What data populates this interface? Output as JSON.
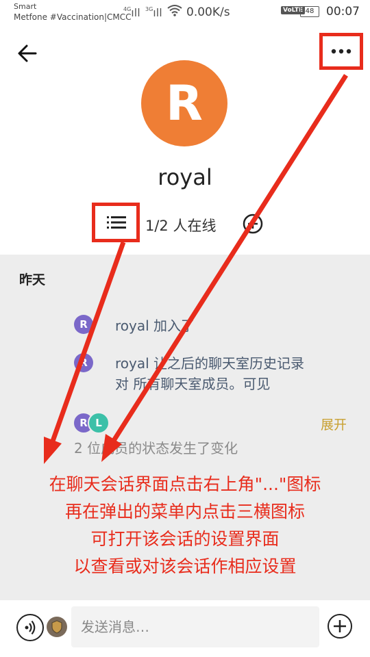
{
  "status_bar": {
    "carrier_line1": "Smart",
    "carrier_line2": "Metfone #Vaccination|CMCC",
    "signal1": "4G",
    "signal2": "3G",
    "net_speed": "0.00K/s",
    "volte": "VoLTE",
    "battery": "48",
    "time": "00:07"
  },
  "header": {
    "avatar_letter": "R",
    "avatar_color": "#ef7e35",
    "room_name": "royal",
    "online_count": "1/2 人在线"
  },
  "timeline": {
    "date_separator": "昨天",
    "events": [
      {
        "avatar_letter": "R",
        "text": "royal 加入了"
      },
      {
        "avatar_letter": "R",
        "text_line1": "royal 让之后的聊天室历史记录",
        "text_line2": "对 所有聊天室成员。可见"
      }
    ],
    "group_avatars": [
      "R",
      "L"
    ],
    "expand_label": "展开",
    "status_change_text": "2 位成员的状态发生了变化"
  },
  "annotation": {
    "lines": [
      "在聊天会话界面点击右上角\"...\"图标",
      "再在弹出的菜单内点击三横图标",
      "可打开该会话的设置界面",
      "以查看或对该会话作相应设置"
    ]
  },
  "composer": {
    "placeholder": "发送消息…"
  },
  "colors": {
    "accent_red": "#e82c1c",
    "avatar_purple": "#7b68c9",
    "avatar_teal": "#3cc0a8",
    "expand_gold": "#c8a030"
  }
}
